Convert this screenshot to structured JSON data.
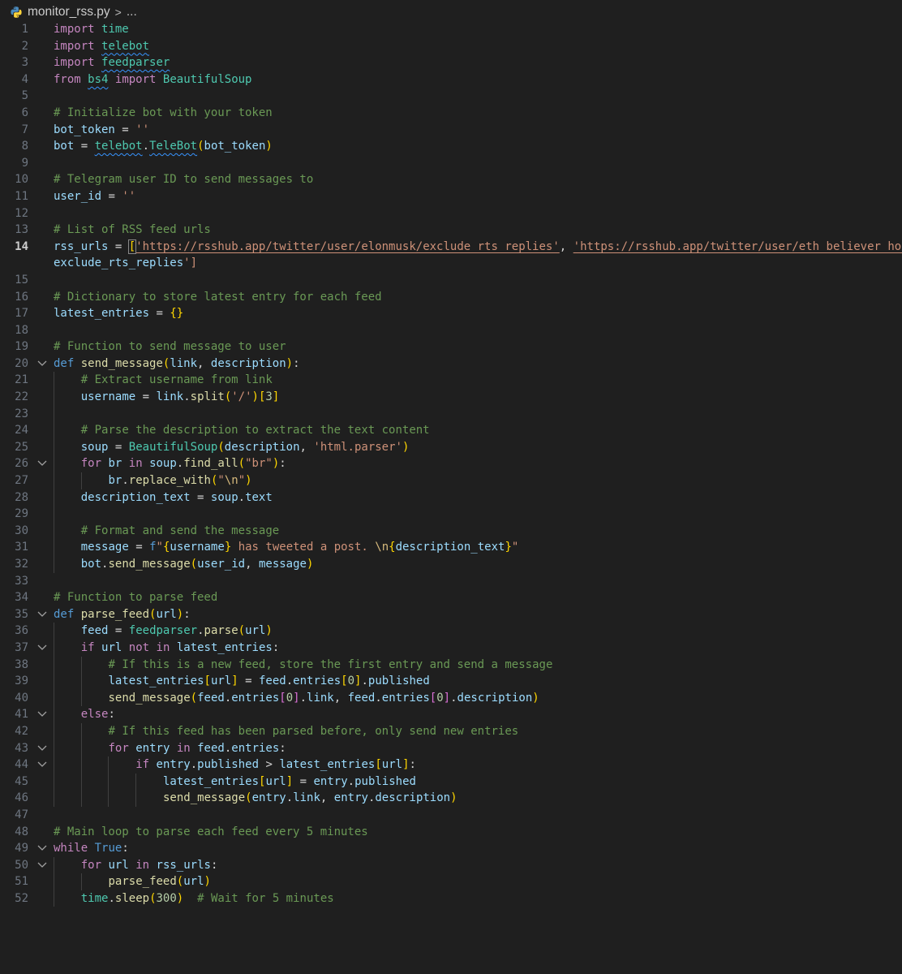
{
  "breadcrumb": {
    "file_name": "monitor_rss.py",
    "separator": ">",
    "more": "..."
  },
  "editor": {
    "language": "python",
    "active_line": 14,
    "line_numbers": [
      "1",
      "2",
      "3",
      "4",
      "5",
      "6",
      "7",
      "8",
      "9",
      "10",
      "11",
      "12",
      "13",
      "14",
      "",
      "15",
      "16",
      "17",
      "18",
      "19",
      "20",
      "21",
      "22",
      "23",
      "24",
      "25",
      "26",
      "27",
      "28",
      "29",
      "30",
      "31",
      "32",
      "33",
      "34",
      "35",
      "36",
      "37",
      "38",
      "39",
      "40",
      "41",
      "42",
      "43",
      "44",
      "45",
      "46",
      "47",
      "48",
      "49",
      "50",
      "51",
      "52"
    ],
    "lines": [
      "import time",
      "import telebot",
      "import feedparser",
      "from bs4 import BeautifulSoup",
      "",
      "# Initialize bot with your token",
      "bot_token = ''",
      "bot = telebot.TeleBot(bot_token)",
      "",
      "# Telegram user ID to send messages to",
      "user_id = ''",
      "",
      "# List of RSS feed urls",
      "rss_urls = ['https://rsshub.app/twitter/user/elonmusk/exclude_rts_replies', 'https://rsshub.app/twitter/user/eth_believer_ho/",
      "exclude_rts_replies']",
      "",
      "# Dictionary to store latest entry for each feed",
      "latest_entries = {}",
      "",
      "# Function to send message to user",
      "def send_message(link, description):",
      "    # Extract username from link",
      "    username = link.split('/')[3]",
      "",
      "    # Parse the description to extract the text content",
      "    soup = BeautifulSoup(description, 'html.parser')",
      "    for br in soup.find_all(\"br\"):",
      "        br.replace_with(\"\\n\")",
      "    description_text = soup.text",
      "",
      "    # Format and send the message",
      "    message = f\"{username} has tweeted a post. \\n{description_text}\"",
      "    bot.send_message(user_id, message)",
      "",
      "# Function to parse feed",
      "def parse_feed(url):",
      "    feed = feedparser.parse(url)",
      "    if url not in latest_entries:",
      "        # If this is a new feed, store the first entry and send a message",
      "        latest_entries[url] = feed.entries[0].published",
      "        send_message(feed.entries[0].link, feed.entries[0].description)",
      "    else:",
      "        # If this feed has been parsed before, only send new entries",
      "        for entry in feed.entries:",
      "            if entry.published > latest_entries[url]:",
      "                latest_entries[url] = entry.published",
      "                send_message(entry.link, entry.description)",
      "",
      "# Main loop to parse each feed every 5 minutes",
      "while True:",
      "    for url in rss_urls:",
      "        parse_feed(url)",
      "    time.sleep(300)  # Wait for 5 minutes"
    ],
    "folded_lines": [
      20,
      26,
      35,
      37,
      41,
      43,
      44,
      49,
      50
    ]
  },
  "colors": {
    "background": "#1f1f1f",
    "keyword": "#c586c0",
    "builtin_keyword": "#569cd6",
    "module_class": "#4ec9b0",
    "variable": "#9cdcfe",
    "function": "#dcdcaa",
    "string": "#ce9178",
    "comment": "#6a9955",
    "number": "#b5cea8",
    "bracket_level1": "#ffd700",
    "bracket_level2": "#da70d6",
    "bracket_level3": "#179fff"
  }
}
